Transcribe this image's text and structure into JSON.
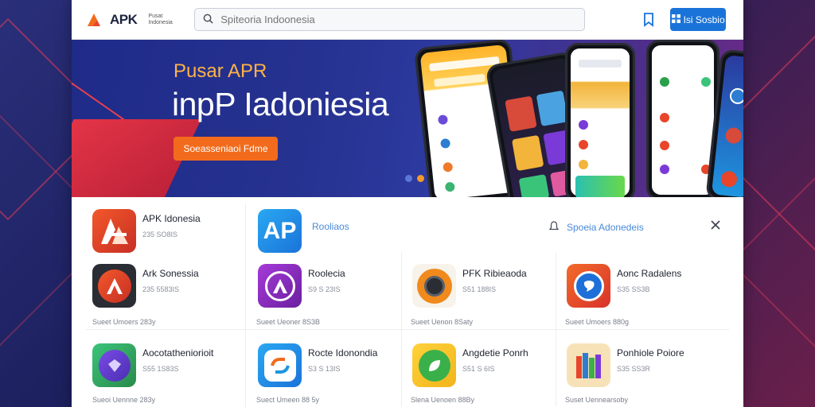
{
  "header": {
    "logo_text": "APK",
    "logo_subtext": "Pusat Indonesia",
    "search_placeholder": "Spiteoria Indoonesia",
    "primary_button": "Isi Sosbio"
  },
  "hero": {
    "kicker": "Pusar APR",
    "title": "inpP Iadoniesia",
    "cta": "Soeasseniaoi Fdme",
    "dots": 2,
    "active_dot": 1
  },
  "filter_row": {
    "featured_app": {
      "icon_text": "AP",
      "label": "Rooliaos"
    },
    "filter_label": "Spoeia Adonedeis"
  },
  "apps": [
    {
      "name": "APK Idonesia",
      "meta": "235 SO8IS",
      "foot": "",
      "icon": "apk-logo-icon",
      "color": "#d8332a"
    },
    {
      "name": "Ark Sonessia",
      "meta": "235 5583IS",
      "foot": "Sueet Umoers 283y",
      "icon": "a-letter-icon",
      "color": "#c72f24"
    },
    {
      "name": "Roolecia",
      "meta": "S9 S 23IS",
      "foot": "Sueet Ueoner 8S3B",
      "icon": "a-letter-icon",
      "color": "#8a2bb8"
    },
    {
      "name": "PFK Ribieaoda",
      "meta": "S51 188IS",
      "foot": "Sueet Uenon 8Saty",
      "icon": "camera-icon",
      "color": "#f08a1c"
    },
    {
      "name": "Aonc Radalens",
      "meta": "S35 SS3B",
      "foot": "Sueet Umoers 880g",
      "icon": "chat-bubble-icon",
      "color": "#e8452a"
    },
    {
      "name": "Aocotatheniorioit",
      "meta": "S55 1S83S",
      "foot": "Sueoi Uennne 283y",
      "icon": "gem-icon",
      "color": "#5a2fb0"
    },
    {
      "name": "Rocte Idonondia",
      "meta": "S3 S 13IS",
      "foot": "Suect Umeen 88 5y",
      "icon": "sync-icon",
      "color": "#1e96e0"
    },
    {
      "name": "Angdetie Ponrh",
      "meta": "S51 S 6IS",
      "foot": "Slena Uenoen 88By",
      "icon": "leaf-icon",
      "color": "#f5c31c"
    },
    {
      "name": "Ponhiole Poiore",
      "meta": "S35 SS3R",
      "foot": "Suset Uennearsoby",
      "icon": "books-icon",
      "color": "#f2d8a8"
    }
  ],
  "colors": {
    "accent": "#1a73d9",
    "cta": "#f26b1d",
    "kicker": "#ffb347"
  }
}
